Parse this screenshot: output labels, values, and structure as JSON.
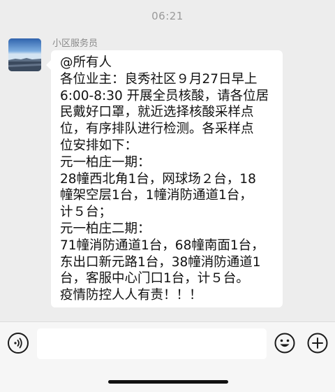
{
  "chat": {
    "timestamp": "06:21",
    "sender_name": "小区服务员",
    "message_lines": [
      "@所有人",
      "各位业主：良秀社区９月27日早上",
      "6:00-8:30 开展全员核酸，请各位居",
      "民戴好口罩，就近选择核酸采样点",
      "位，有序排队进行检测。各采样点",
      "位安排如下：",
      "元一柏庄一期：",
      "28幢西北角1台，网球场２台，18",
      "幢架空层1台，1幢消防通道1台，",
      "计５台；",
      "元一柏庄二期：",
      "71幢消防通道1台，68幢南面1台，",
      "东出口新元路1台，38幢消防通道1",
      "台，客服中心门口1台，计５台。",
      "疫情防控人人有责！！！"
    ]
  },
  "input_bar": {
    "input_value": "",
    "voice_icon": "voice-icon",
    "emoji_icon": "emoji-icon",
    "plus_icon": "plus-icon"
  },
  "colors": {
    "background": "#ededed",
    "bubble": "#ffffff",
    "input_bar": "#f6f6f6",
    "text": "#111111",
    "muted": "#9a9a9a"
  }
}
